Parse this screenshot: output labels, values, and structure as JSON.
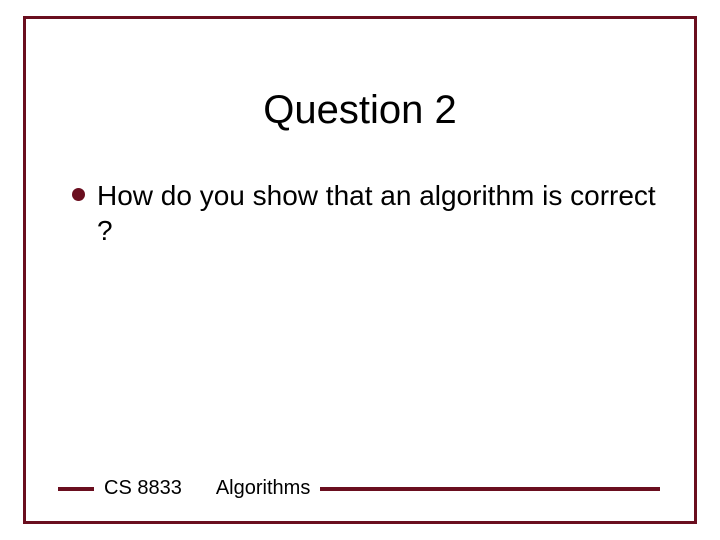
{
  "colors": {
    "accent": "#6a0e1f"
  },
  "slide": {
    "title": "Question 2",
    "bullets": [
      {
        "text": "How do you show that an algorithm is correct ?"
      }
    ],
    "footer": {
      "course": "CS 8833",
      "topic": "Algorithms"
    }
  }
}
